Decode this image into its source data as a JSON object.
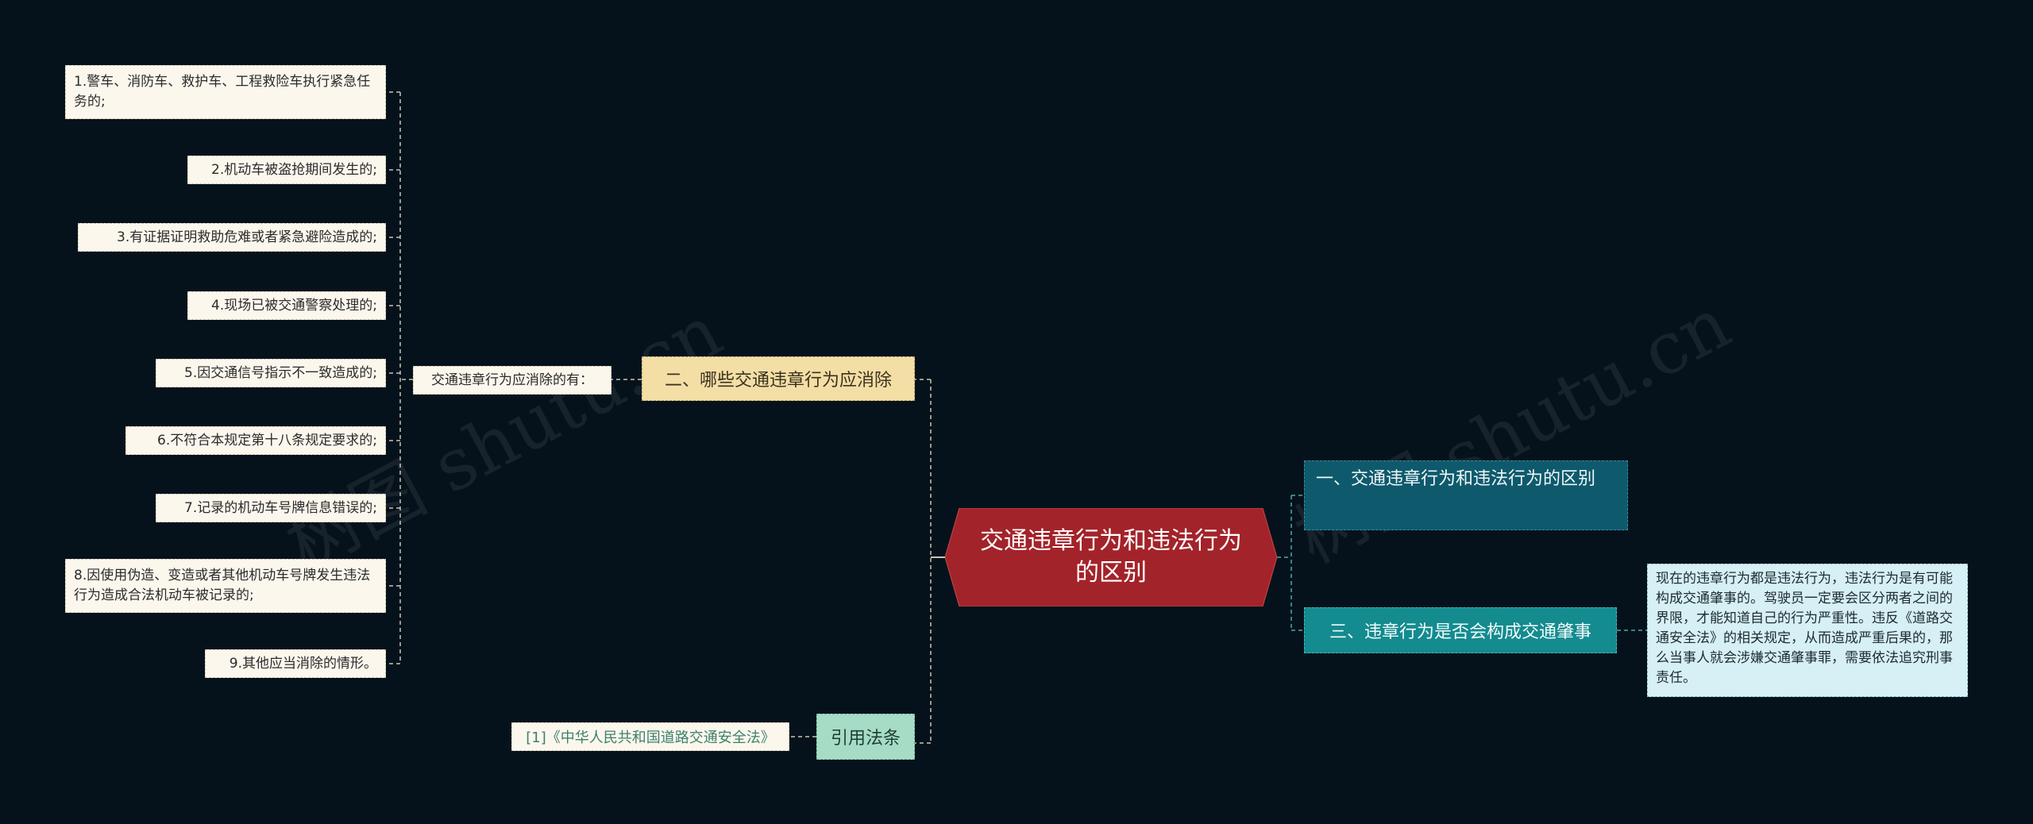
{
  "center": {
    "label": "交通违章行为和违法行为的区别"
  },
  "branch2": {
    "label": "二、哪些交通违章行为应消除",
    "sub": "交通违章行为应消除的有：",
    "items": [
      "1.警车、消防车、救护车、工程救险车执行紧急任务的;",
      "2.机动车被盗抢期间发生的;",
      "3.有证据证明救助危难或者紧急避险造成的;",
      "4.现场已被交通警察处理的;",
      "5.因交通信号指示不一致造成的;",
      "6.不符合本规定第十八条规定要求的;",
      "7.记录的机动车号牌信息错误的;",
      "8.因使用伪造、变造或者其他机动车号牌发生违法行为造成合法机动车被记录的;",
      "9.其他应当消除的情形。"
    ]
  },
  "citation": {
    "label": "引用法条",
    "item": "[1]《中华人民共和国道路交通安全法》"
  },
  "branch1": {
    "label": "一、交通违章行为和违法行为的区别"
  },
  "branch3": {
    "label": "三、违章行为是否会构成交通肇事",
    "desc": "现在的违章行为都是违法行为，违法行为是有可能构成交通肇事的。驾驶员一定要会区分两者之间的界限，才能知道自己的行为严重性。违反《道路交通安全法》的相关规定，从而造成严重后果的，那么当事人就会涉嫌交通肇事罪，需要依法追究刑事责任。"
  },
  "watermark": "树图 shutu.cn",
  "colors": {
    "background": "#06121b",
    "center": "#a3232a",
    "yellow": "#f3dfa5",
    "green": "#a6dcc6",
    "dark_teal": "#0e5a6c",
    "teal": "#138b8f",
    "light_blue": "#d6f0f5"
  }
}
